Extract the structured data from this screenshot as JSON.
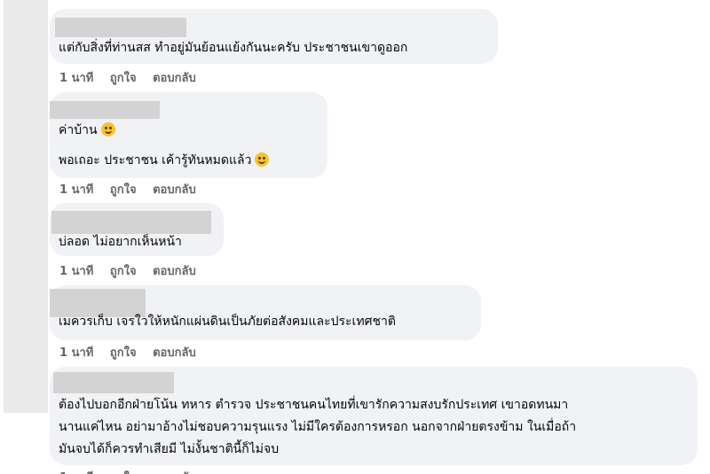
{
  "actions": {
    "time": "1 นาที",
    "like": "ถูกใจ",
    "reply": "ตอบกลับ"
  },
  "comments": [
    {
      "lines": [
        "แต่กับสิ่งที่ท่านสส ทำอยู่มันย้อนแย้งกันนะครับ ประชาชนเขาดูออก"
      ]
    },
    {
      "lines": [
        "ค่าบ้าน",
        "พอเถอะ ประชาชน เค้ารู้ทันหมดแล้ว"
      ]
    },
    {
      "lines": [
        "บ่ลอด ไม่อยากเห็นหน้า"
      ]
    },
    {
      "lines": [
        "เมควรเก็บ เจรใวให้หนักแผ่นดินเป็นภัยต่อสังคมและประเทศชาติ"
      ]
    },
    {
      "lines": [
        "ต้องไปบอกอีกฝ่ายโน้น ทหาร ตำรวจ ประชาชนคนไทยที่เขารักความสงบรักประเทศ เขาอดทนมา",
        "นานแค่ไหน อย่ามาอ้างไม่ชอบความรุนแรง ไม่มีใครต้องการหรอก นอกจากฝ่ายตรงข้าม ในเมื่อถ้า",
        "มันจบได้ก็ควรทำเสียมี ไม่งั้นชาตินี้ก็ไม่จบ"
      ]
    }
  ]
}
